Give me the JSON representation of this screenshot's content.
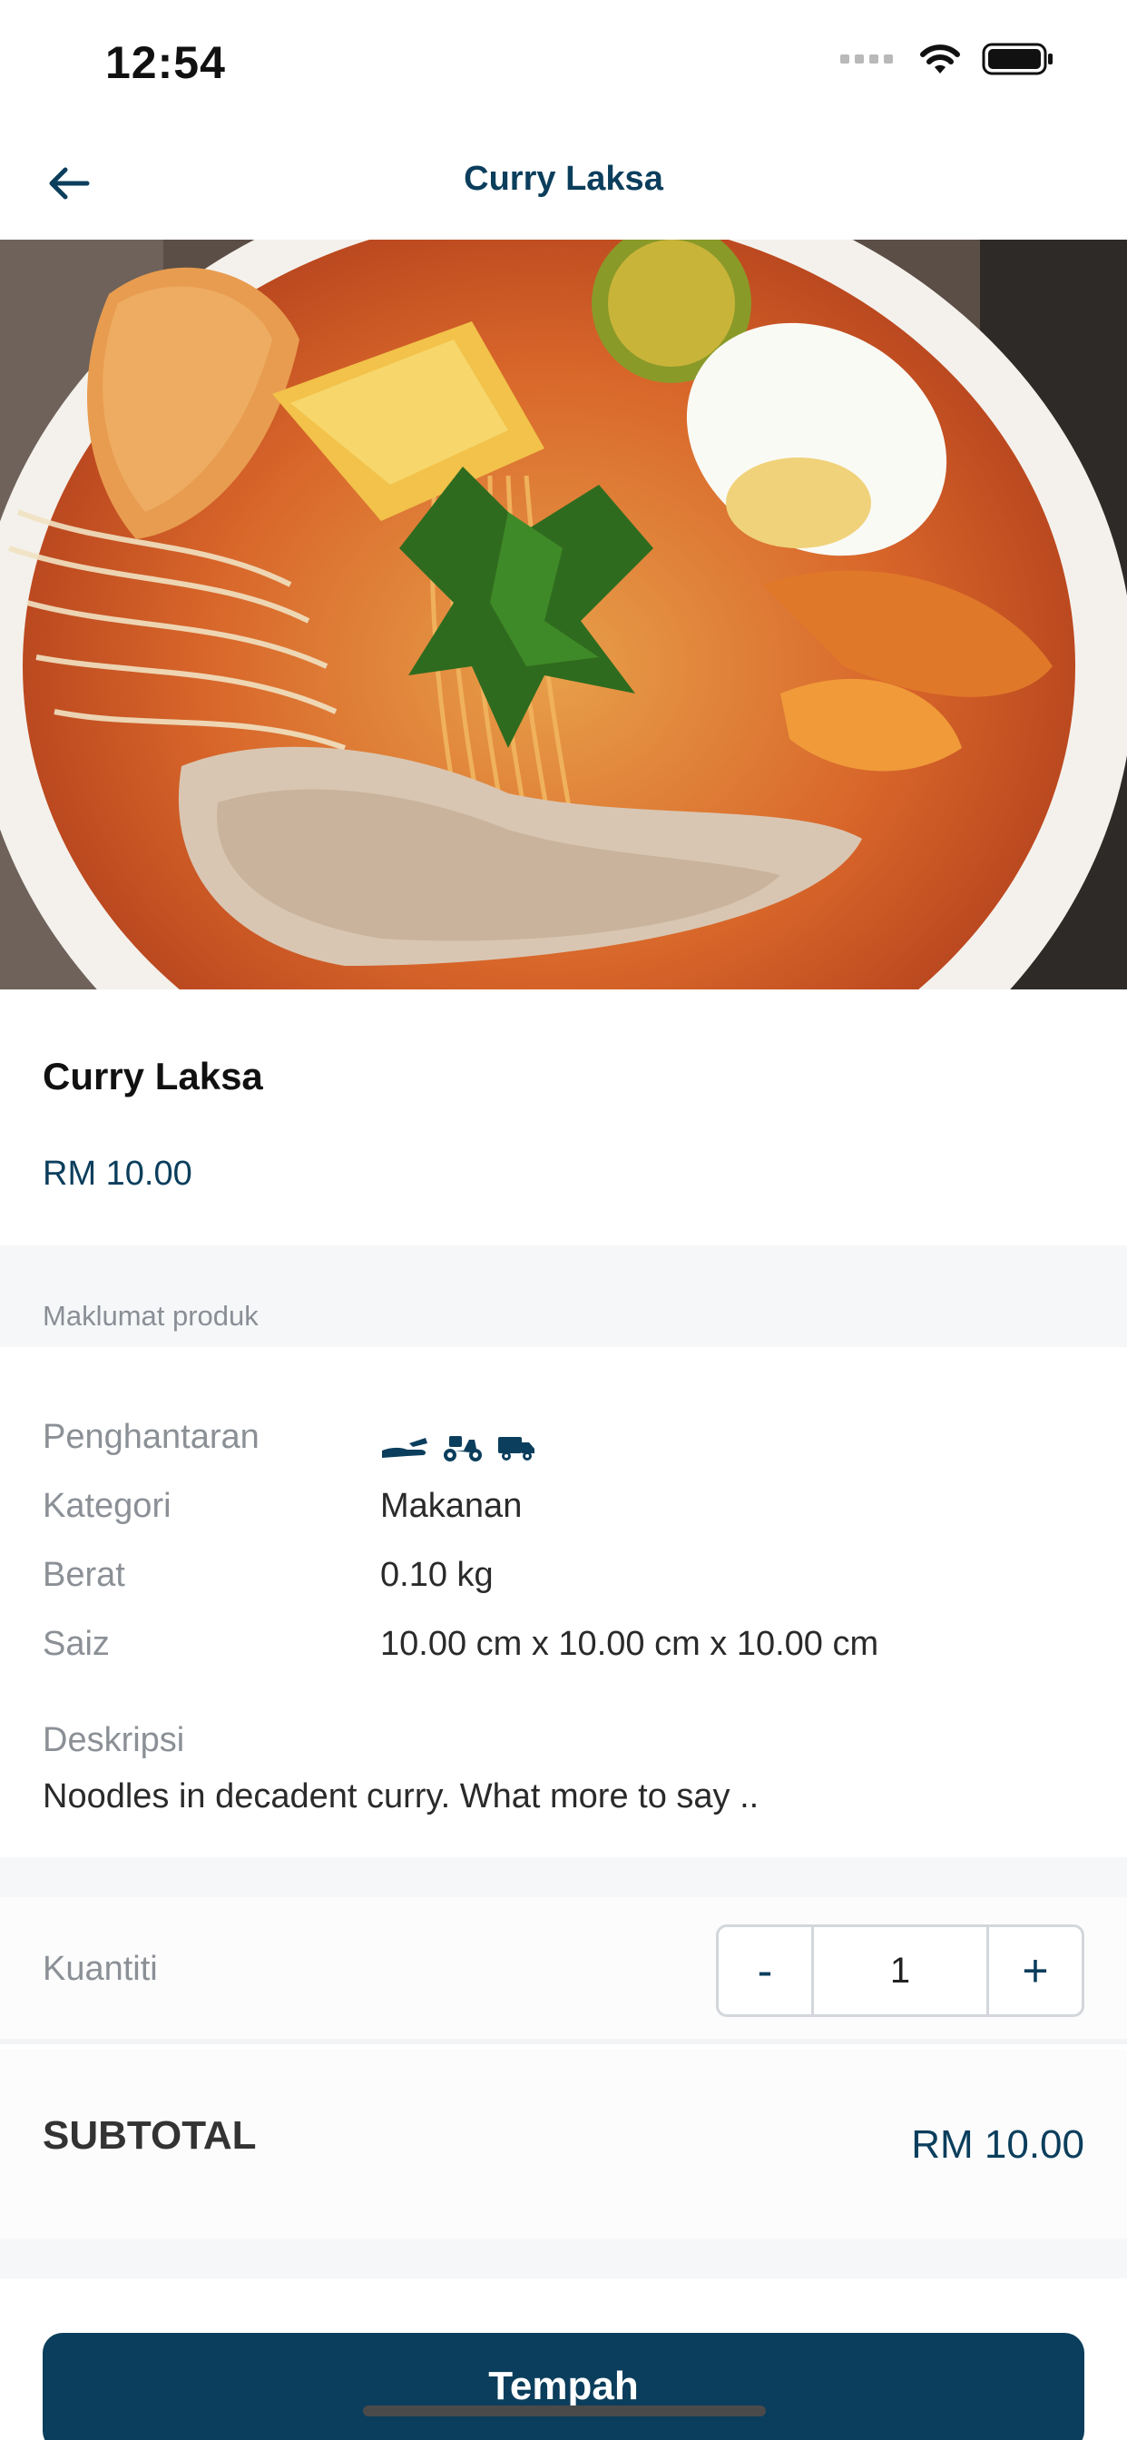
{
  "status_bar": {
    "time": "12:54",
    "icons": [
      "signal-dots",
      "wifi-icon",
      "battery-icon"
    ]
  },
  "nav": {
    "title": "Curry Laksa",
    "back_icon": "arrow-left-icon"
  },
  "hero": {
    "image": "curry laksa bowl photo"
  },
  "product": {
    "name": "Curry Laksa",
    "price": "RM 10.00"
  },
  "section": {
    "label": "Maklumat produk"
  },
  "details": {
    "delivery": {
      "label": "Penghantaran",
      "icons": [
        "hand-pickup-icon",
        "motorbike-icon",
        "truck-icon"
      ]
    },
    "category": {
      "label": "Kategori",
      "value": "Makanan"
    },
    "weight": {
      "label": "Berat",
      "value": "0.10 kg"
    },
    "size": {
      "label": "Saiz",
      "value": "10.00 cm x 10.00 cm x 10.00 cm"
    },
    "description": {
      "label": "Deskripsi",
      "value": "Noodles in decadent curry. What more to say .."
    }
  },
  "quantity": {
    "label": "Kuantiti",
    "minus": "-",
    "value": "1",
    "plus": "+"
  },
  "subtotal": {
    "label": "SUBTOTAL",
    "value": "RM 10.00"
  },
  "footer": {
    "order_button": "Tempah"
  },
  "colors": {
    "accent": "#0b3e5c",
    "muted": "#8b9096",
    "band": "#f6f7f9"
  }
}
